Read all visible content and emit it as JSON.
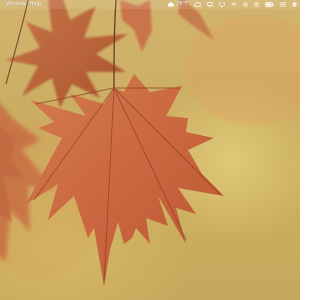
{
  "menubar": {
    "menus": [
      {
        "label": "Window"
      },
      {
        "label": "Help"
      }
    ],
    "status": {
      "weather_icon": "cloud-icon",
      "weather_temp": "78°F",
      "icons": [
        "cloud-sync-icon",
        "display-icon",
        "airplay-icon",
        "wifi-icon",
        "settings-icon",
        "focus-icon",
        "battery-icon",
        "control-center-icon",
        "siri-icon"
      ]
    }
  },
  "wallpaper": {
    "subject": "red japanese maple leaves on a blurred golden background"
  }
}
